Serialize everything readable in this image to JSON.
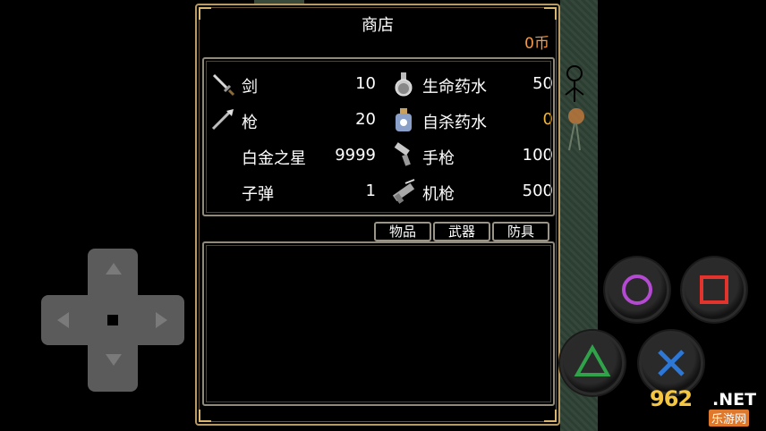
{
  "shop": {
    "title": "商店",
    "coins": "0币"
  },
  "items": [
    {
      "name": "剑",
      "value": "10",
      "icon": "sword-icon"
    },
    {
      "name": "生命药水",
      "value": "50",
      "icon": "health-potion-icon"
    },
    {
      "name": "枪",
      "value": "20",
      "icon": "spear-icon"
    },
    {
      "name": "自杀药水",
      "value": "0",
      "icon": "suicide-potion-icon"
    },
    {
      "name": "白金之星",
      "value": "9999",
      "icon": ""
    },
    {
      "name": "手枪",
      "value": "100",
      "icon": "pistol-icon"
    },
    {
      "name": "子弹",
      "value": "1",
      "icon": ""
    },
    {
      "name": "机枪",
      "value": "500",
      "icon": "machine-gun-icon"
    }
  ],
  "tabs": [
    "物品",
    "武器",
    "防具"
  ],
  "controls": {
    "dpad": "dpad",
    "buttons": [
      "circle",
      "square",
      "triangle",
      "cross"
    ]
  },
  "watermark": {
    "main": "962",
    "net": ".NET",
    "sub": "乐游网"
  },
  "colors": {
    "coins": "#f29a4a",
    "zero_value": "#f0b63c",
    "frame_gold": "#b89a62",
    "circle": "#b34ad1",
    "square": "#e2342c",
    "triangle": "#2fa24a",
    "cross": "#2d77d6"
  }
}
